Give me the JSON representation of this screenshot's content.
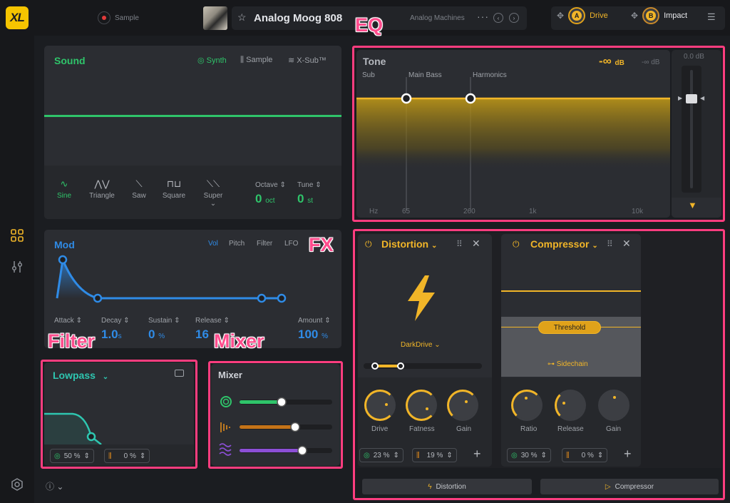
{
  "topbar": {
    "logo": "XL",
    "sample_label": "Sample",
    "preset_name": "Analog Moog 808",
    "bank": "Analog Machines",
    "more": "···",
    "macro_a": {
      "letter": "A",
      "label": "Drive"
    },
    "macro_b": {
      "letter": "B",
      "label": "Impact"
    }
  },
  "annotations": {
    "eq": "EQ",
    "fx": "FX",
    "filter": "Filter",
    "mixer": "Mixer"
  },
  "sound": {
    "title": "Sound",
    "tabs": [
      "Synth",
      "Sample",
      "X-Sub™"
    ],
    "waveforms": [
      "Sine",
      "Triangle",
      "Saw",
      "Square",
      "Super"
    ],
    "octave": {
      "label": "Octave",
      "value": "0",
      "unit": "oct"
    },
    "tune": {
      "label": "Tune",
      "value": "0",
      "unit": "st"
    }
  },
  "mod": {
    "title": "Mod",
    "tabs": [
      "Vol",
      "Pitch",
      "Filter",
      "LFO"
    ],
    "attack": {
      "label": "Attack",
      "value": ""
    },
    "decay": {
      "label": "Decay",
      "value": "1.0",
      "unit": "s"
    },
    "sustain": {
      "label": "Sustain",
      "value": "0",
      "unit": "%"
    },
    "release": {
      "label": "Release",
      "value": "16"
    },
    "amount": {
      "label": "Amount",
      "value": "100",
      "unit": "%"
    }
  },
  "filter": {
    "title": "Lowpass",
    "mix_a": "50 %",
    "mix_b": "0 %"
  },
  "mixer": {
    "title": "Mixer",
    "levels": [
      0.45,
      0.6,
      0.68
    ]
  },
  "tone": {
    "title": "Tone",
    "gain": "-∞",
    "gain_unit": "dB",
    "gain_secondary": "-∞ dB",
    "bands": [
      "Sub",
      "Main Bass",
      "Harmonics"
    ],
    "freq_ticks": [
      "Hz",
      "65",
      "260",
      "1k",
      "10k"
    ],
    "fader_readout": "0.0 dB"
  },
  "distortion": {
    "title": "Distortion",
    "mode": "DarkDrive",
    "knobs": [
      "Drive",
      "Fatness",
      "Gain"
    ],
    "mix_a": "23 %",
    "mix_b": "19 %"
  },
  "compressor": {
    "title": "Compressor",
    "threshold": "Threshold",
    "sidechain": "Sidechain",
    "knobs": [
      "Ratio",
      "Release",
      "Gain"
    ],
    "mix_a": "30 %",
    "mix_b": "0 %"
  },
  "fx_tabs": [
    "Distortion",
    "Compressor"
  ],
  "colors": {
    "accent": "#f1b528",
    "green": "#2fc46a",
    "blue": "#2f8be6",
    "teal": "#2ec6b0",
    "annotation": "#ff3d7f"
  }
}
